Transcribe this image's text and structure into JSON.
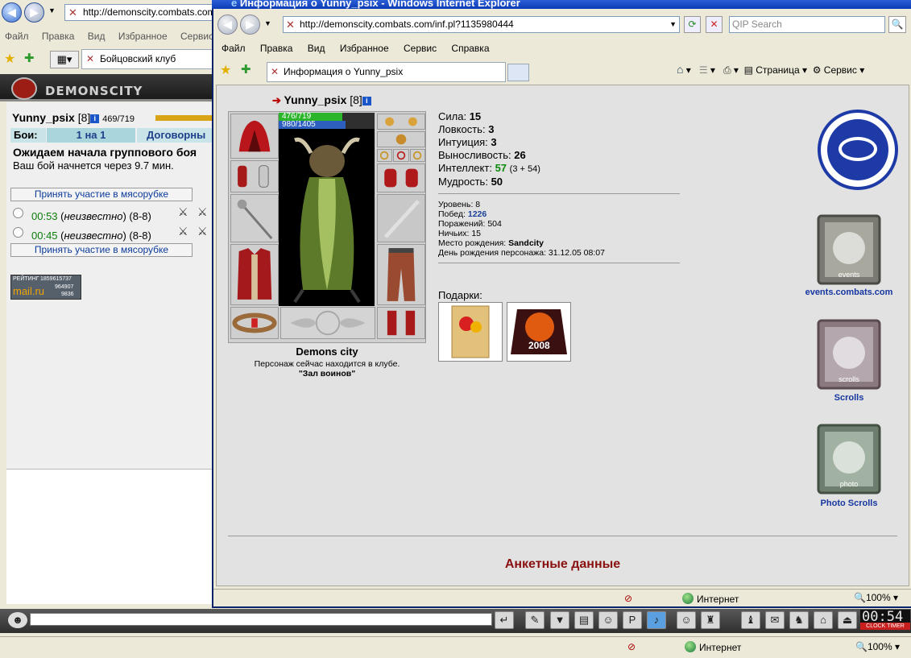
{
  "bg_window": {
    "address": "http://demonscity.combats.com/",
    "menu": [
      "Файл",
      "Правка",
      "Вид",
      "Избранное",
      "Сервис"
    ],
    "tab_label": "Бойцовский клуб",
    "banner_title": "DEMONSCITY",
    "player": {
      "name": "Yunny_psix",
      "level": "[8]",
      "hp": "469/719"
    },
    "fights_label": "Бои:",
    "fight_tabs": [
      "1 на 1",
      "Договорны"
    ],
    "waiting_text": "Ожидаем начала группового боя",
    "countdown_text": "Ваш бой начнется через 9.7 мин.",
    "join_button": "Принять участие в мясорубке",
    "fights": [
      {
        "time": "00:53",
        "who": "неизвестно",
        "range": "(8-8)"
      },
      {
        "time": "00:45",
        "who": "неизвестно",
        "range": "(8-8)"
      }
    ],
    "counter": {
      "label": "РЕЙТИНГ",
      "brand": "mail.ru",
      "v1": "1859615737",
      "v2": "964907",
      "v3": "9836"
    },
    "status_zone": "Интернет",
    "zoom": "100%",
    "clock": "00:54",
    "clock_label": "CLOCK TIMER"
  },
  "front_window": {
    "title": "Информация о Yunny_psix - Windows Internet Explorer",
    "address": "http://demonscity.combats.com/inf.pl?1135980444",
    "search_placeholder": "QIP Search",
    "menu": [
      "Файл",
      "Правка",
      "Вид",
      "Избранное",
      "Сервис",
      "Справка"
    ],
    "tab_label": "Информация о Yunny_psix",
    "tools": {
      "page": "Страница",
      "service": "Сервис"
    },
    "status_zone": "Интернет",
    "zoom": "100%"
  },
  "character": {
    "name": "Yunny_psix",
    "level": "[8]",
    "hp": "476/719",
    "hp_fraction": 0.662,
    "mana": "980/1405",
    "mana_fraction": 0.698,
    "city": "Demons city",
    "location_text": "Персонаж сейчас находится в клубе.",
    "location_room": "\"Зал воинов\"",
    "stats": [
      {
        "label": "Сила:",
        "value": "15",
        "extra": ""
      },
      {
        "label": "Ловкость:",
        "value": "3",
        "extra": ""
      },
      {
        "label": "Интуиция:",
        "value": "3",
        "extra": ""
      },
      {
        "label": "Выносливость:",
        "value": "26",
        "extra": ""
      },
      {
        "label": "Интеллект:",
        "value": "57",
        "extra": "(3 + 54)"
      },
      {
        "label": "Мудрость:",
        "value": "50",
        "extra": ""
      }
    ],
    "details": [
      {
        "label": "Уровень:",
        "value": "8"
      },
      {
        "label": "Побед:",
        "value": "1226"
      },
      {
        "label": "Поражений:",
        "value": "504"
      },
      {
        "label": "Ничьих:",
        "value": "15"
      },
      {
        "label": "Место рождения:",
        "value": "Sandcity"
      },
      {
        "label": "День рождения персонажа:",
        "value": "31.12.05 08:07"
      }
    ],
    "gifts_label": "Подарки:",
    "gift_card_text": "2008",
    "side_links": [
      "events.combats.com",
      "Scrolls",
      "Photo Scrolls"
    ],
    "scroll_captions": [
      "events",
      "scrolls",
      "photo"
    ],
    "profile_heading": "Анкетные данные"
  },
  "colors": {
    "accent": "#1b3f9a",
    "green": "#0a7d0a",
    "heading": "#8a1010"
  }
}
